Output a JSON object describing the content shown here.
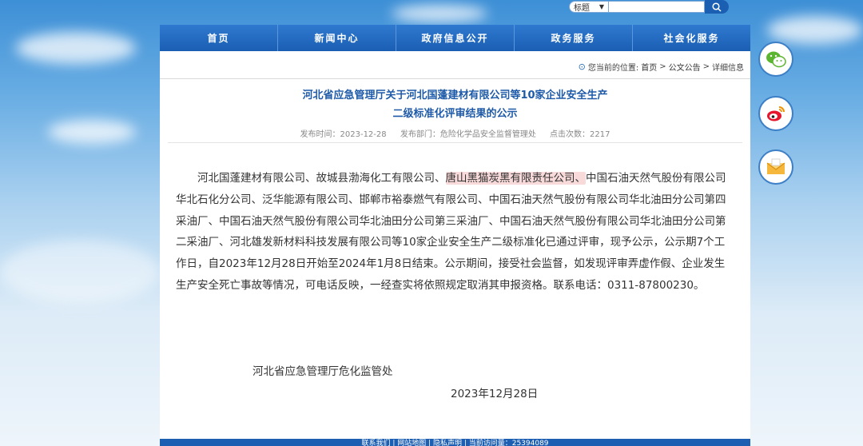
{
  "search": {
    "category_selected": "标题",
    "value": ""
  },
  "nav": {
    "items": [
      "首页",
      "新闻中心",
      "政府信息公开",
      "政务服务",
      "社会化服务"
    ]
  },
  "breadcrumb": {
    "prefix": "您当前的位置:",
    "home": "首页",
    "sep1": ">",
    "section": "公文公告",
    "sep2": ">",
    "current": "详细信息"
  },
  "article": {
    "title_line1": "河北省应急管理厅关于河北国蓬建材有限公司等10家企业安全生产",
    "title_line2": "二级标准化评审结果的公示",
    "meta": {
      "published": "发布时间：2023-12-28",
      "department": "发布部门：危险化学品安全监督管理处",
      "views": "点击次数：2217"
    },
    "body_part1": "河北国蓬建材有限公司、故城县渤海化工有限公司、",
    "body_highlight": "唐山黑猫炭黑有限责任公司、",
    "body_part2": "中国石油天然气股份有限公司华北石化分公司、泛华能源有限公司、邯郸市裕泰燃气有限公司、中国石油天然气股份有限公司华北油田分公司第四采油厂、中国石油天然气股份有限公司华北油田分公司第三采油厂、中国石油天然气股份有限公司华北油田分公司第二采油厂、河北雄发新材料科技发展有限公司等10家企业安全生产二级标准化已通过评审，现予公示，公示期7个工作日，自2023年12月28日开始至2024年1月8日结束。公示期间，接受社会监督，如发现评审弄虚作假、企业发生生产安全死亡事故等情况，可电话反映，一经查实将依照规定取消其申报资格。联系电话：0311-87800230。",
    "signature": "河北省应急管理厅危化监管处",
    "date": "2023年12月28日"
  },
  "footer": {
    "text": "联系我们 | 网站地图 | 隐私声明 | 当前访问量：25394089"
  },
  "side_icons": [
    "wechat-icon",
    "weibo-icon",
    "mail-icon"
  ],
  "colors": {
    "nav": "#1a5eb3",
    "title": "#1e5aa8",
    "highlight": "#f8dada"
  }
}
